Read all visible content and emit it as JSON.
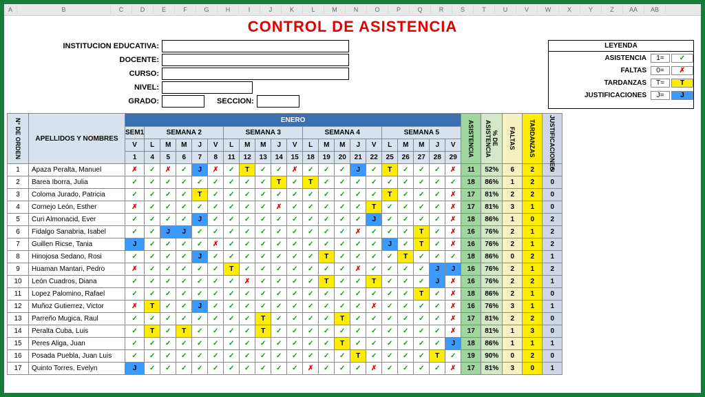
{
  "columns": [
    "A",
    "B",
    "C",
    "D",
    "E",
    "F",
    "G",
    "H",
    "I",
    "J",
    "K",
    "L",
    "M",
    "N",
    "O",
    "P",
    "Q",
    "R",
    "S",
    "T",
    "U",
    "V",
    "W",
    "X",
    "Y",
    "Z",
    "AA",
    "AB"
  ],
  "title": "CONTROL DE ASISTENCIA",
  "fields": {
    "institucion": "INSTITUCION EDUCATIVA:",
    "docente": "DOCENTE:",
    "curso": "CURSO:",
    "nivel": "NIVEL:",
    "grado": "GRADO:",
    "seccion": "SECCION:"
  },
  "legend": {
    "title": "LEYENDA",
    "rows": [
      {
        "label": "ASISTENCIA",
        "code": "1=",
        "sym": "✓",
        "cls": "check"
      },
      {
        "label": "FALTAS",
        "code": "0=",
        "sym": "✗",
        "cls": "cross"
      },
      {
        "label": "TARDANZAS",
        "code": "T=",
        "sym": "T",
        "cls": "tard"
      },
      {
        "label": "JUSTIFICACIONES",
        "code": "J=",
        "sym": "J",
        "cls": "just"
      }
    ]
  },
  "table": {
    "orden": "N° DE ORDEN",
    "nombres": "APELLIDOS Y NOMBRES",
    "month": "ENERO",
    "weeks": [
      "SEM1",
      "SEMANA 2",
      "SEMANA 3",
      "SEMANA 4",
      "SEMANA 5"
    ],
    "weekspans": [
      1,
      5,
      5,
      5,
      5
    ],
    "dayletters": [
      "V",
      "L",
      "M",
      "M",
      "J",
      "V",
      "L",
      "M",
      "M",
      "J",
      "V",
      "L",
      "M",
      "M",
      "J",
      "V",
      "L",
      "M",
      "M",
      "J",
      "V"
    ],
    "daynums": [
      "1",
      "4",
      "5",
      "6",
      "7",
      "8",
      "11",
      "12",
      "13",
      "14",
      "15",
      "18",
      "19",
      "20",
      "21",
      "22",
      "25",
      "26",
      "27",
      "28",
      "29"
    ],
    "stat_headers": [
      "ASISTENCIA",
      "% DE ASISTENCIA",
      "FALTAS",
      "TARDANZAS",
      "JUSTIFICACIONES"
    ],
    "stat_cls": [
      "asist",
      "pct",
      "falt",
      "tard",
      "just"
    ],
    "rows": [
      {
        "n": 1,
        "name": "Apaza Peralta, Manuel",
        "cells": [
          "x",
          "v",
          "x",
          "v",
          "j",
          "x",
          "v",
          "t",
          "v",
          "v",
          "x",
          "v",
          "v",
          "v",
          "j",
          "v",
          "t",
          "v",
          "v",
          "v",
          "x"
        ],
        "stats": [
          "11",
          "52%",
          "6",
          "2",
          "2"
        ]
      },
      {
        "n": 2,
        "name": "Barea Iborra, Julia",
        "cells": [
          "v",
          "v",
          "v",
          "v",
          "v",
          "v",
          "v",
          "v",
          "v",
          "t",
          "v",
          "t",
          "v",
          "v",
          "v",
          "v",
          "v",
          "v",
          "v",
          "v",
          "v"
        ],
        "stats": [
          "18",
          "86%",
          "1",
          "2",
          "0"
        ]
      },
      {
        "n": 3,
        "name": "Coloma Jurado, Patricia",
        "cells": [
          "v",
          "v",
          "v",
          "v",
          "t",
          "v",
          "v",
          "v",
          "v",
          "v",
          "v",
          "v",
          "v",
          "v",
          "v",
          "v",
          "t",
          "v",
          "v",
          "v",
          "x"
        ],
        "stats": [
          "17",
          "81%",
          "2",
          "2",
          "0"
        ]
      },
      {
        "n": 4,
        "name": "Cornejo León, Esther",
        "cells": [
          "x",
          "v",
          "v",
          "v",
          "v",
          "v",
          "v",
          "v",
          "v",
          "x",
          "v",
          "v",
          "v",
          "v",
          "v",
          "t",
          "v",
          "v",
          "v",
          "v",
          "x"
        ],
        "stats": [
          "17",
          "81%",
          "3",
          "1",
          "0"
        ]
      },
      {
        "n": 5,
        "name": "Curi Almonacid, Ever",
        "cells": [
          "v",
          "v",
          "v",
          "v",
          "j",
          "v",
          "v",
          "v",
          "v",
          "v",
          "v",
          "v",
          "v",
          "v",
          "v",
          "j",
          "v",
          "v",
          "v",
          "v",
          "x"
        ],
        "stats": [
          "18",
          "86%",
          "1",
          "0",
          "2"
        ]
      },
      {
        "n": 6,
        "name": "Fidalgo Sanabria, Isabel",
        "cells": [
          "v",
          "v",
          "j",
          "j",
          "v",
          "v",
          "v",
          "v",
          "v",
          "v",
          "v",
          "v",
          "v",
          "v",
          "x",
          "v",
          "v",
          "v",
          "t",
          "v",
          "x"
        ],
        "stats": [
          "16",
          "76%",
          "2",
          "1",
          "2"
        ]
      },
      {
        "n": 7,
        "name": "Guillen Ricse, Tania",
        "cells": [
          "j",
          "v",
          "v",
          "v",
          "v",
          "x",
          "v",
          "v",
          "v",
          "v",
          "v",
          "v",
          "v",
          "v",
          "v",
          "v",
          "j",
          "v",
          "t",
          "v",
          "x"
        ],
        "stats": [
          "16",
          "76%",
          "2",
          "1",
          "2"
        ]
      },
      {
        "n": 8,
        "name": "Hinojosa Sedano, Rosi",
        "cells": [
          "v",
          "v",
          "v",
          "v",
          "j",
          "v",
          "v",
          "v",
          "v",
          "v",
          "v",
          "v",
          "t",
          "v",
          "v",
          "v",
          "v",
          "t",
          "v",
          "v",
          "v"
        ],
        "stats": [
          "18",
          "86%",
          "0",
          "2",
          "1"
        ]
      },
      {
        "n": 9,
        "name": "Huaman Mantari, Pedro",
        "cells": [
          "x",
          "v",
          "v",
          "v",
          "v",
          "v",
          "t",
          "v",
          "v",
          "v",
          "v",
          "v",
          "v",
          "v",
          "x",
          "v",
          "v",
          "v",
          "v",
          "j",
          "j"
        ],
        "stats": [
          "16",
          "76%",
          "2",
          "1",
          "2"
        ]
      },
      {
        "n": 10,
        "name": "León Cuadros, Diana",
        "cells": [
          "v",
          "v",
          "v",
          "v",
          "v",
          "v",
          "v",
          "x",
          "v",
          "v",
          "v",
          "v",
          "t",
          "v",
          "v",
          "t",
          "v",
          "v",
          "v",
          "j",
          "x"
        ],
        "stats": [
          "16",
          "76%",
          "2",
          "2",
          "1"
        ]
      },
      {
        "n": 11,
        "name": "Lopez Palomino, Rafael",
        "cells": [
          "v",
          "v",
          "v",
          "v",
          "v",
          "v",
          "v",
          "v",
          "v",
          "v",
          "v",
          "v",
          "v",
          "v",
          "v",
          "v",
          "v",
          "v",
          "t",
          "v",
          "x"
        ],
        "stats": [
          "18",
          "86%",
          "2",
          "1",
          "0"
        ]
      },
      {
        "n": 12,
        "name": "Muñoz Gutierrez, Victor",
        "cells": [
          "x",
          "t",
          "v",
          "v",
          "j",
          "v",
          "v",
          "v",
          "v",
          "v",
          "v",
          "v",
          "v",
          "v",
          "v",
          "x",
          "v",
          "v",
          "v",
          "v",
          "x"
        ],
        "stats": [
          "16",
          "76%",
          "3",
          "1",
          "1"
        ]
      },
      {
        "n": 13,
        "name": "Parreño Mugica, Raul",
        "cells": [
          "v",
          "v",
          "v",
          "v",
          "v",
          "v",
          "v",
          "v",
          "t",
          "v",
          "v",
          "v",
          "v",
          "t",
          "v",
          "v",
          "v",
          "v",
          "v",
          "v",
          "x"
        ],
        "stats": [
          "17",
          "81%",
          "2",
          "2",
          "0"
        ]
      },
      {
        "n": 14,
        "name": "Peralta Cuba, Luis",
        "cells": [
          "v",
          "t",
          "v",
          "t",
          "v",
          "v",
          "v",
          "v",
          "t",
          "v",
          "v",
          "v",
          "v",
          "v",
          "v",
          "v",
          "v",
          "v",
          "v",
          "v",
          "x"
        ],
        "stats": [
          "17",
          "81%",
          "1",
          "3",
          "0"
        ]
      },
      {
        "n": 15,
        "name": "Peres Aliga, Juan",
        "cells": [
          "v",
          "v",
          "v",
          "v",
          "v",
          "v",
          "v",
          "v",
          "v",
          "v",
          "v",
          "v",
          "v",
          "t",
          "v",
          "v",
          "v",
          "v",
          "v",
          "v",
          "j"
        ],
        "stats": [
          "18",
          "86%",
          "1",
          "1",
          "1"
        ]
      },
      {
        "n": 16,
        "name": "Posada Puebla, Juan Luis",
        "cells": [
          "v",
          "v",
          "v",
          "v",
          "v",
          "v",
          "v",
          "v",
          "v",
          "v",
          "v",
          "v",
          "v",
          "v",
          "t",
          "v",
          "v",
          "v",
          "v",
          "t",
          "v"
        ],
        "stats": [
          "19",
          "90%",
          "0",
          "2",
          "0"
        ]
      },
      {
        "n": 17,
        "name": "Quinto Torres, Evelyn",
        "cells": [
          "j",
          "v",
          "v",
          "v",
          "v",
          "v",
          "v",
          "v",
          "v",
          "v",
          "v",
          "x",
          "v",
          "v",
          "v",
          "x",
          "v",
          "v",
          "v",
          "v",
          "x"
        ],
        "stats": [
          "17",
          "81%",
          "3",
          "0",
          "1"
        ]
      }
    ]
  }
}
